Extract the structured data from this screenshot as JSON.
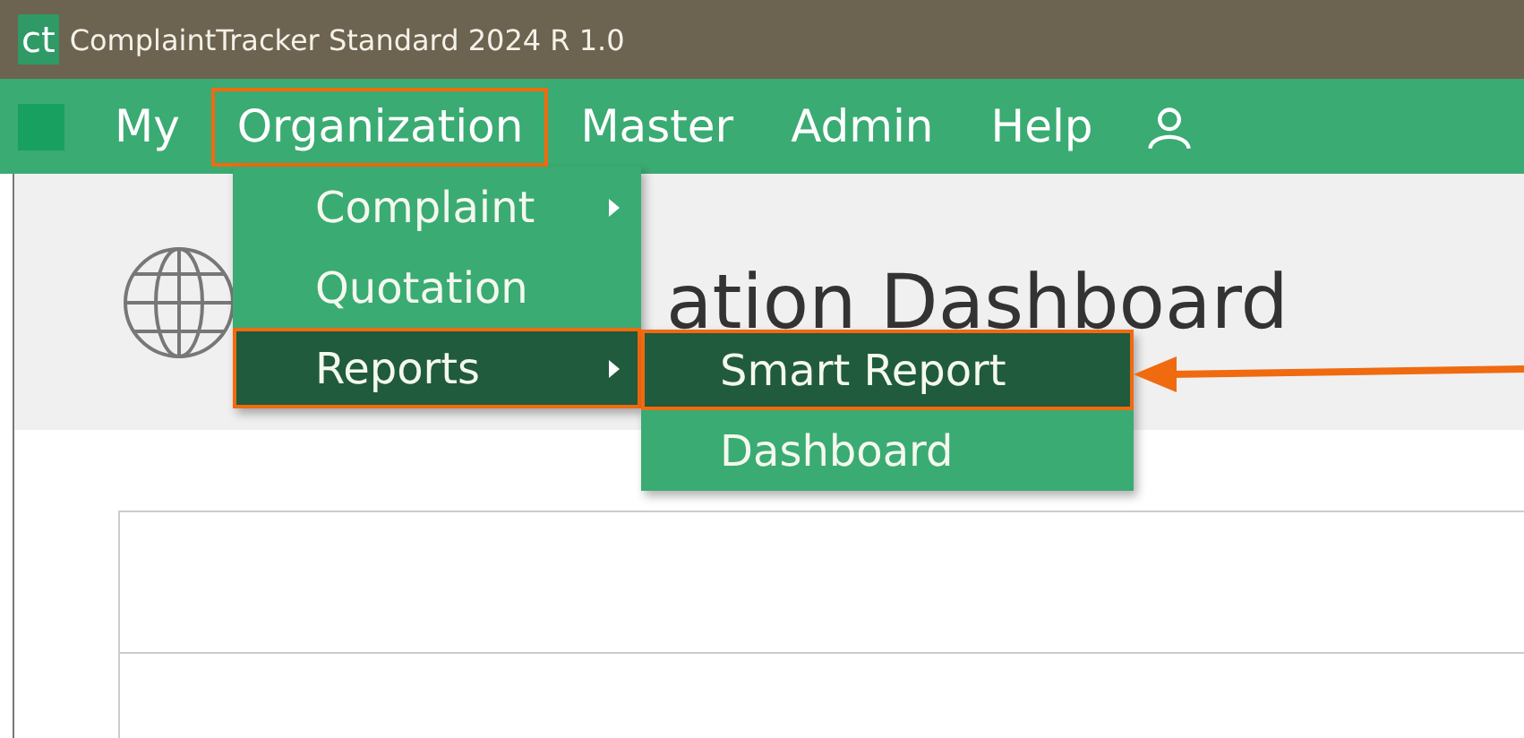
{
  "window": {
    "logo": "ct",
    "title": "ComplaintTracker Standard 2024 R 1.0"
  },
  "menubar": {
    "items": [
      {
        "label": "My",
        "highlighted": false
      },
      {
        "label": "Organization",
        "highlighted": true
      },
      {
        "label": "Master",
        "highlighted": false
      },
      {
        "label": "Admin",
        "highlighted": false
      },
      {
        "label": "Help",
        "highlighted": false
      }
    ]
  },
  "dropdown": {
    "items": [
      {
        "label": "Complaint",
        "has_submenu": true,
        "selected": false,
        "highlighted": false
      },
      {
        "label": "Quotation",
        "has_submenu": false,
        "selected": false,
        "highlighted": false
      },
      {
        "label": "Reports",
        "has_submenu": true,
        "selected": true,
        "highlighted": true
      }
    ]
  },
  "submenu": {
    "items": [
      {
        "label": "Smart Report",
        "selected": true,
        "highlighted": true
      },
      {
        "label": "Dashboard",
        "selected": false,
        "highlighted": false
      }
    ]
  },
  "page": {
    "heading": "ation Dashboard"
  },
  "annotation": {
    "arrow": true
  }
}
